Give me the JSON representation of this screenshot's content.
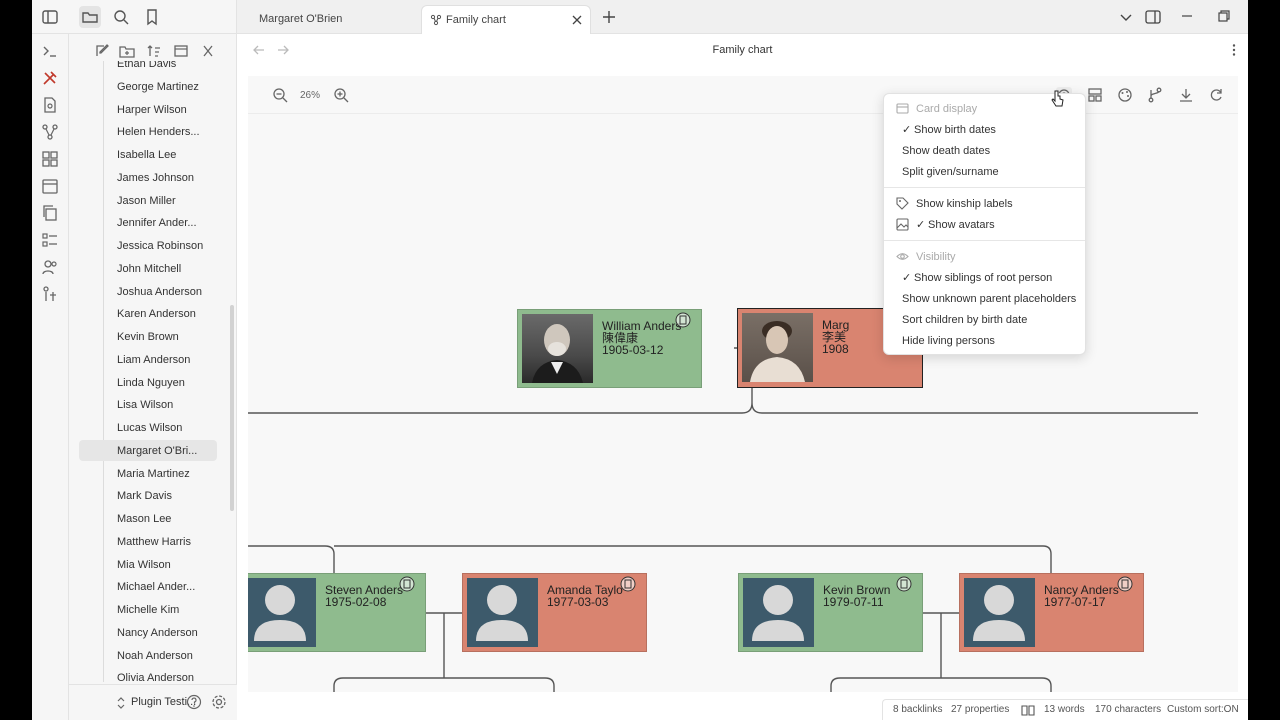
{
  "tabs": [
    {
      "label": "Margaret O'Brien",
      "active": false
    },
    {
      "label": "Family chart",
      "active": true
    }
  ],
  "view_title": "Family chart",
  "zoom_level": "26%",
  "files": [
    "Ethan Davis",
    "George Martinez",
    "Harper Wilson",
    "Helen Henders...",
    "Isabella Lee",
    "James Johnson",
    "Jason Miller",
    "Jennifer Ander...",
    "Jessica Robinson",
    "John Mitchell",
    "Joshua Anderson",
    "Karen Anderson",
    "Kevin Brown",
    "Liam Anderson",
    "Linda Nguyen",
    "Lisa Wilson",
    "Lucas Wilson",
    "Margaret O'Bri...",
    "Maria Martinez",
    "Mark Davis",
    "Mason Lee",
    "Matthew Harris",
    "Mia Wilson",
    "Michael Ander...",
    "Michelle Kim",
    "Nancy Anderson",
    "Noah Anderson",
    "Olivia Anderson"
  ],
  "selected_file": "Margaret O'Bri...",
  "vault_name": "Plugin Testi...",
  "menu": {
    "card_display": "Card display",
    "show_birth_dates": "Show birth dates",
    "show_death_dates": "Show death dates",
    "split_names": "Split given/surname",
    "show_kinship": "Show kinship labels",
    "show_avatars": "Show avatars",
    "visibility": "Visibility",
    "show_siblings": "Show siblings of root person",
    "show_unknown": "Show unknown parent placeholders",
    "sort_children": "Sort children by birth date",
    "hide_living": "Hide living persons"
  },
  "people": {
    "william": {
      "name": "William Anders",
      "alt_name": "陳偉康",
      "dates": "1905-03-12"
    },
    "margaret": {
      "name": "Marg",
      "alt_name": "李美",
      "dates": "1908"
    },
    "steven": {
      "name": "Steven Anders",
      "dates": "1975-02-08"
    },
    "amanda": {
      "name": "Amanda Taylo",
      "dates": "1977-03-03"
    },
    "kevin": {
      "name": "Kevin Brown",
      "dates": "1979-07-11"
    },
    "nancy": {
      "name": "Nancy Anders",
      "dates": "1977-07-17"
    }
  },
  "status": {
    "backlinks": "8 backlinks",
    "properties": "27 properties",
    "words": "13 words",
    "characters": "170 characters",
    "custom_sort": "Custom sort:ON"
  },
  "colors": {
    "male_card": "#8fbb8e",
    "female_card": "#d98470",
    "avatar_bg": "#3d5a6b"
  }
}
